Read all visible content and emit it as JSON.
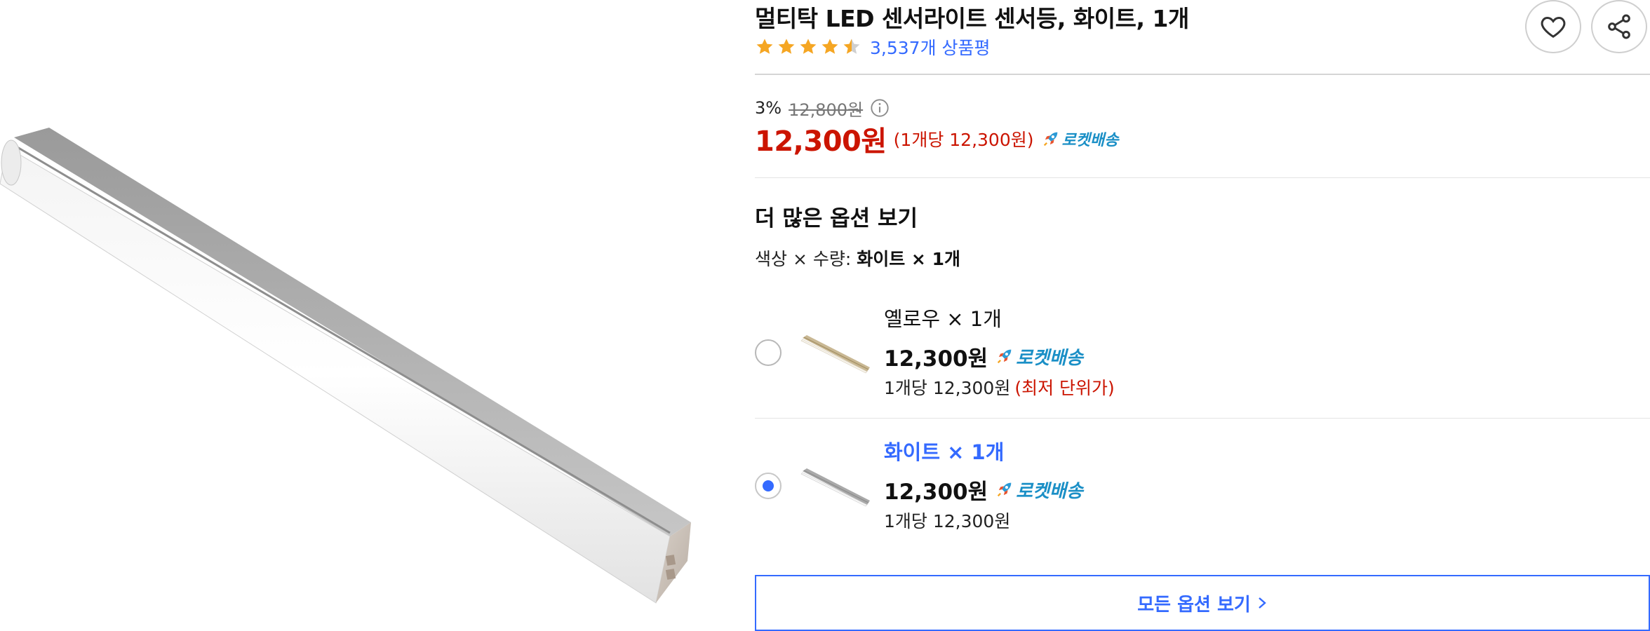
{
  "product": {
    "title": "멀티탁 LED 센서라이트 센서등, 화이트, 1개",
    "rating_stars": 4.5,
    "review_count": "3,537개 상품평",
    "image": "led-light-bar-photo"
  },
  "actions": {
    "wishlist_icon": "heart-icon",
    "share_icon": "share-icon"
  },
  "pricing": {
    "discount_rate": "3%",
    "original_price": "12,800원",
    "info_icon": "info-icon",
    "sale_price": "12,300원",
    "unit_price": "(1개당 12,300원)",
    "rocket_label": "로켓배송"
  },
  "options": {
    "section_title": "더 많은 옵션 보기",
    "selected_label": "색상 × 수량:",
    "selected_value": "화이트 × 1개",
    "items": [
      {
        "name": "옐로우 × 1개",
        "price": "12,300원",
        "rocket_label": "로켓배송",
        "unit_price": "1개당 12,300원",
        "note": "(최저 단위가)",
        "selected": false
      },
      {
        "name": "화이트 × 1개",
        "price": "12,300원",
        "rocket_label": "로켓배송",
        "unit_price": "1개당 12,300원",
        "note": "",
        "selected": true
      }
    ],
    "all_options_label": "모든 옵션 보기"
  },
  "colors": {
    "accent_blue": "#346aff",
    "price_red": "#cb1400",
    "star_orange": "#f5a623",
    "rocket_blue": "#1a8fc6"
  }
}
